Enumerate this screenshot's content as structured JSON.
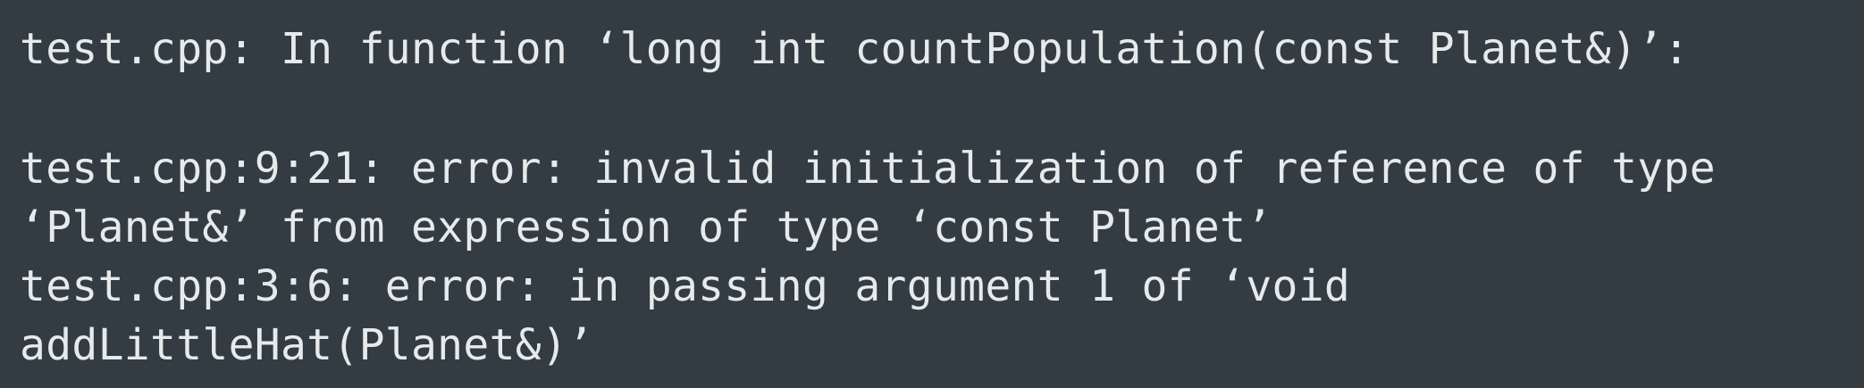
{
  "terminal": {
    "lines": [
      "test.cpp: In function ‘long int countPopulation(const Planet&)’:",
      "",
      "test.cpp:9:21: error: invalid initialization of reference of type",
      "‘Planet&’ from expression of type ‘const Planet’",
      "test.cpp:3:6: error: in passing argument 1 of ‘void",
      "addLittleHat(Planet&)’"
    ]
  }
}
